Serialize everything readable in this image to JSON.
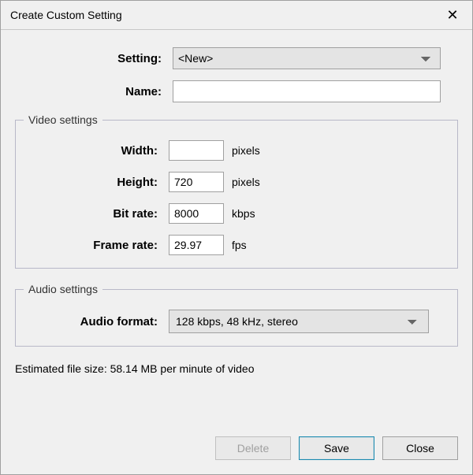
{
  "title": "Create Custom Setting",
  "labels": {
    "setting": "Setting:",
    "name": "Name:",
    "width": "Width:",
    "height": "Height:",
    "bit_rate": "Bit rate:",
    "frame_rate": "Frame rate:",
    "audio_format": "Audio format:"
  },
  "fieldsets": {
    "video": "Video settings",
    "audio": "Audio settings"
  },
  "setting_select": {
    "value": "<New>"
  },
  "name_input": {
    "value": ""
  },
  "video": {
    "width": {
      "value": "",
      "unit": "pixels"
    },
    "height": {
      "value": "720",
      "unit": "pixels"
    },
    "bit_rate": {
      "value": "8000",
      "unit": "kbps"
    },
    "frame_rate": {
      "value": "29.97",
      "unit": "fps"
    }
  },
  "audio": {
    "format": "128 kbps, 48 kHz, stereo"
  },
  "estimate": "Estimated file size: 58.14 MB per minute of video",
  "buttons": {
    "delete": "Delete",
    "save": "Save",
    "close": "Close"
  }
}
